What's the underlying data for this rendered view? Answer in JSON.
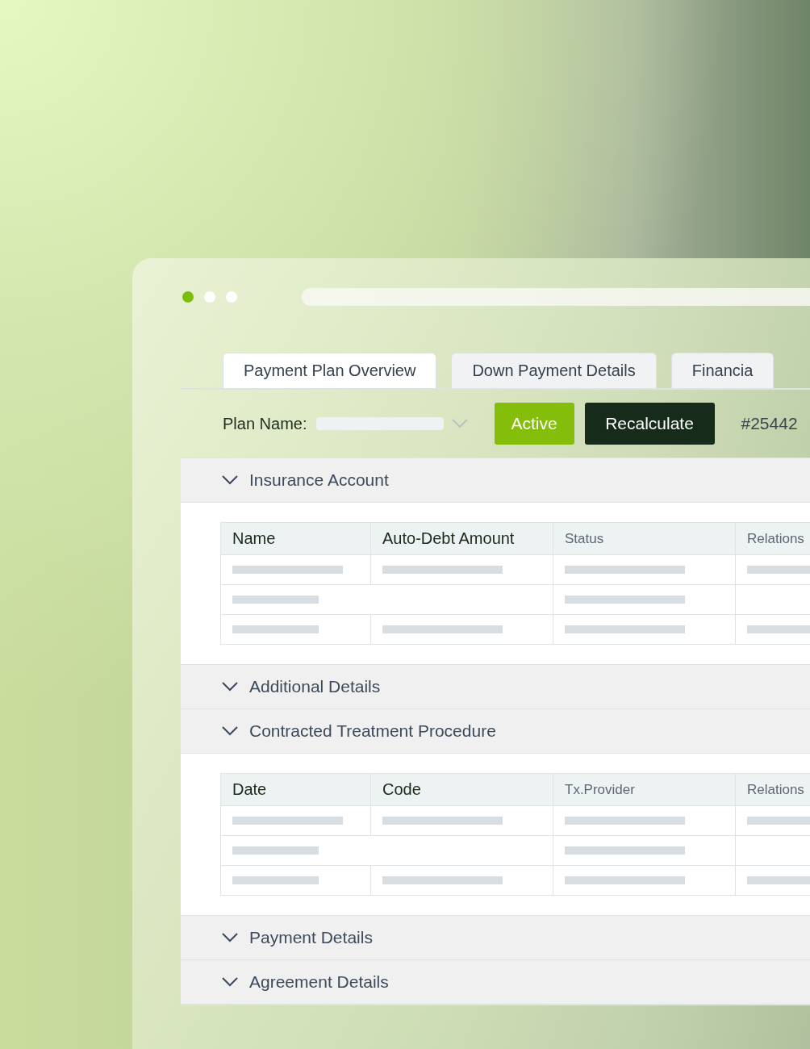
{
  "window": {
    "dots": [
      {
        "color": "#7dbe0c"
      },
      {
        "color": "#ffffff"
      },
      {
        "color": "#ffffff"
      }
    ]
  },
  "tabs": [
    {
      "label": "Payment Plan Overview",
      "selected": true
    },
    {
      "label": "Down Payment Details",
      "selected": false
    },
    {
      "label": "Financia",
      "selected": false
    }
  ],
  "toolbar": {
    "plan_label": "Plan Name:",
    "status": "Active",
    "action": "Recalculate",
    "plan_number": "#25442"
  },
  "sections": [
    {
      "title": "Insurance Account",
      "table": {
        "columns": [
          {
            "label": "Name",
            "kind": "primary"
          },
          {
            "label": "Auto-Debt Amount",
            "kind": "primary"
          },
          {
            "label": "Status",
            "kind": "secondary"
          },
          {
            "label": "Relations",
            "kind": "secondary"
          }
        ],
        "rows": [
          {
            "kind": "full"
          },
          {
            "kind": "merged"
          },
          {
            "kind": "full"
          }
        ]
      }
    },
    {
      "title": "Additional Details"
    },
    {
      "title": "Contracted Treatment Procedure",
      "table": {
        "columns": [
          {
            "label": "Date",
            "kind": "primary"
          },
          {
            "label": "Code",
            "kind": "primary"
          },
          {
            "label": "Tx.Provider",
            "kind": "secondary"
          },
          {
            "label": "Relations",
            "kind": "secondary"
          }
        ],
        "rows": [
          {
            "kind": "full"
          },
          {
            "kind": "merged"
          },
          {
            "kind": "full"
          }
        ]
      }
    },
    {
      "title": "Payment Details"
    },
    {
      "title": "Agreement Details"
    }
  ]
}
